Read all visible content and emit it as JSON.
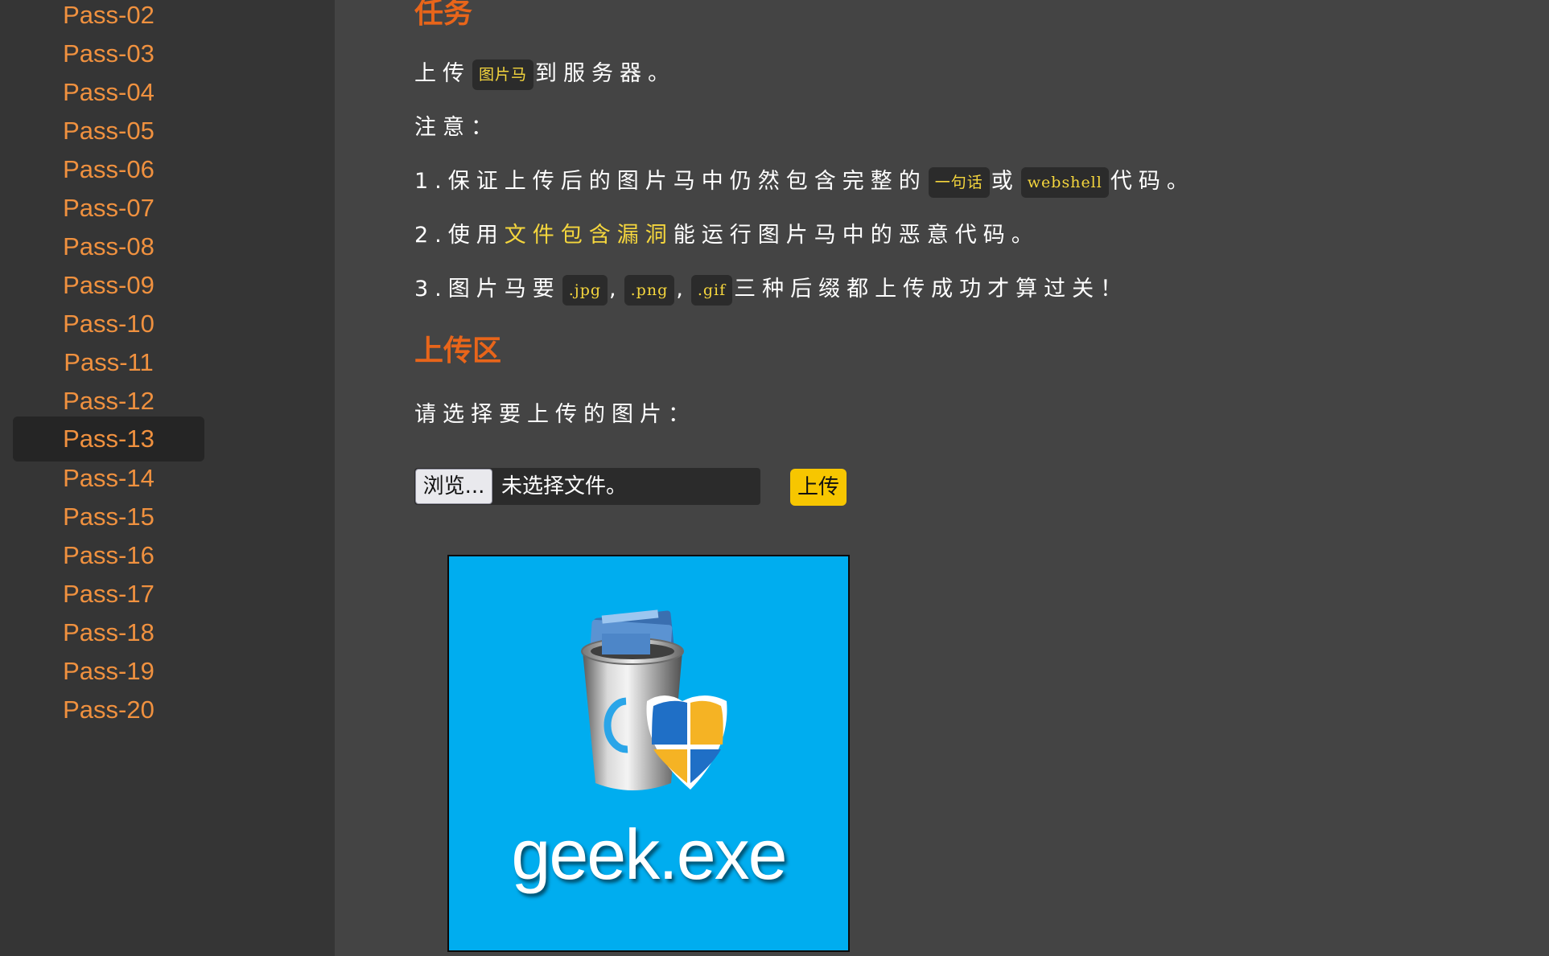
{
  "sidebar": {
    "items": [
      {
        "label": "Pass-02"
      },
      {
        "label": "Pass-03"
      },
      {
        "label": "Pass-04"
      },
      {
        "label": "Pass-05"
      },
      {
        "label": "Pass-06"
      },
      {
        "label": "Pass-07"
      },
      {
        "label": "Pass-08"
      },
      {
        "label": "Pass-09"
      },
      {
        "label": "Pass-10"
      },
      {
        "label": "Pass-11"
      },
      {
        "label": "Pass-12"
      },
      {
        "label": "Pass-13"
      },
      {
        "label": "Pass-14"
      },
      {
        "label": "Pass-15"
      },
      {
        "label": "Pass-16"
      },
      {
        "label": "Pass-17"
      },
      {
        "label": "Pass-18"
      },
      {
        "label": "Pass-19"
      },
      {
        "label": "Pass-20"
      }
    ],
    "active": "Pass-13"
  },
  "task": {
    "heading": "任务",
    "line1": {
      "pre": "上传",
      "code": "图片马",
      "post": "到服务器。"
    },
    "note_label": "注意：",
    "item1": {
      "pre": "1.保证上传后的图片马中仍然包含完整的",
      "code1": "一句话",
      "mid": "或",
      "code2": "webshell",
      "post": "代码。"
    },
    "item2": {
      "pre": "2.使用",
      "highlight": "文件包含漏洞",
      "post": "能运行图片马中的恶意代码。"
    },
    "item3": {
      "pre": "3.图片马要",
      "code1": ".jpg",
      "sep1": ",",
      "code2": ".png",
      "sep2": ",",
      "code3": ".gif",
      "post": "三种后缀都上传成功才算过关！"
    }
  },
  "upload": {
    "heading": "上传区",
    "prompt": "请选择要上传的图片：",
    "browse_label": "浏览...",
    "file_status": "未选择文件。",
    "submit_label": "上传"
  },
  "preview": {
    "caption": "geek.exe",
    "icon": "recycle-bin-with-shield-icon"
  },
  "colors": {
    "accent_orange": "#e8651a",
    "nav_text": "#f0913f",
    "code_text": "#f5d63d",
    "button_yellow": "#f7c600",
    "preview_bg": "#00adef"
  }
}
